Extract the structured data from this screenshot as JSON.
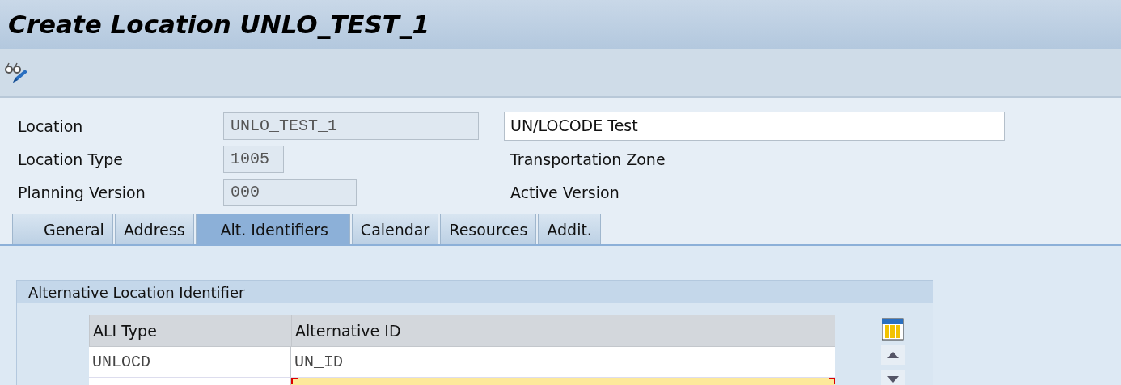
{
  "window": {
    "title": "Create Location UNLO_TEST_1"
  },
  "toolbar": {
    "buttons": [
      {
        "kind": "display_change"
      }
    ]
  },
  "header_fields": [
    {
      "label": "Location",
      "value": "UNLO_TEST_1",
      "side": {
        "kind": "input",
        "value": "UN/LOCODE Test"
      }
    },
    {
      "label": "Location Type",
      "value": "1005",
      "side": {
        "kind": "text",
        "value": "Transportation Zone"
      }
    },
    {
      "label": "Planning Version",
      "value": "000",
      "side": {
        "kind": "text",
        "value": "Active Version"
      }
    }
  ],
  "tabs": [
    {
      "label": "General",
      "selected": false
    },
    {
      "label": "Address",
      "selected": false
    },
    {
      "label": "Alt. Identifiers",
      "selected": true
    },
    {
      "label": "Calendar",
      "selected": false
    },
    {
      "label": "Resources",
      "selected": false
    },
    {
      "label": "Addit.",
      "selected": false
    }
  ],
  "group": {
    "title": "Alternative Location Identifier",
    "table": {
      "columns": [
        "ALI Type",
        "Alternative ID"
      ],
      "rows": [
        {
          "kind": "entry",
          "cells": [
            "UNLOCD",
            "UN_ID"
          ]
        },
        {
          "kind": "new_entry"
        }
      ]
    }
  }
}
